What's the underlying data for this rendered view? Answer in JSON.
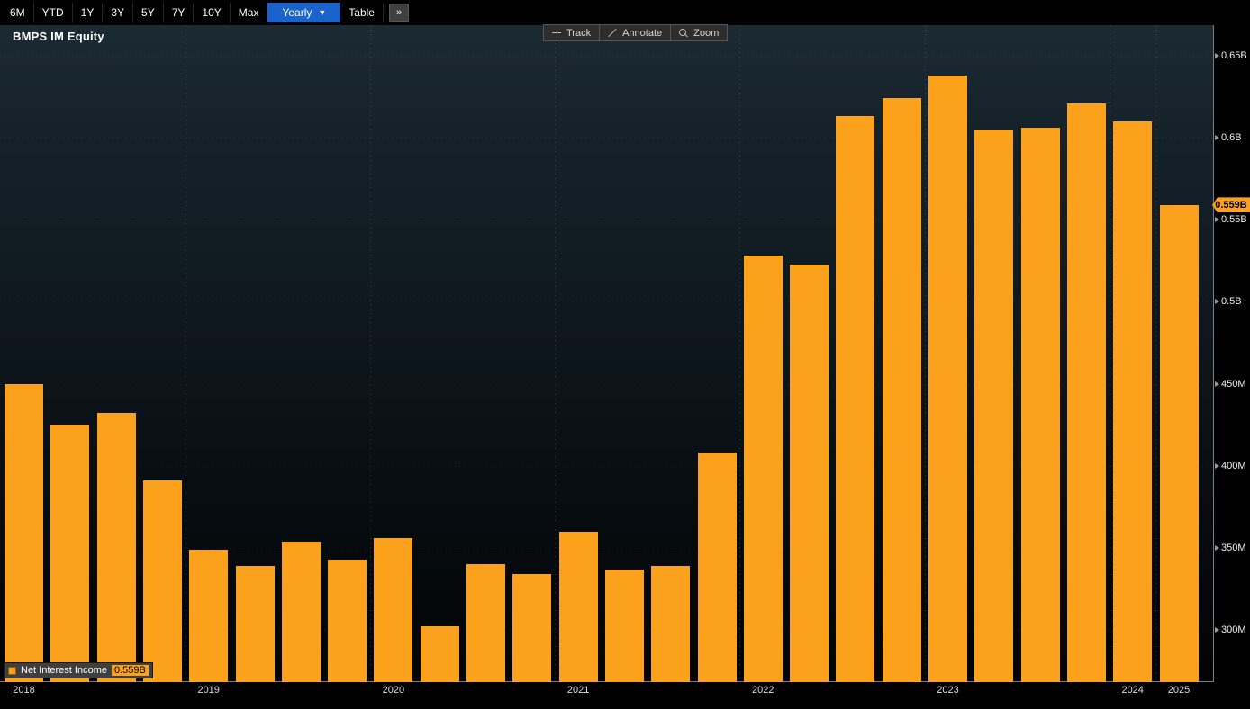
{
  "title": "BMPS IM Equity",
  "toolbar": {
    "period_buttons": [
      "6M",
      "YTD",
      "1Y",
      "3Y",
      "5Y",
      "7Y",
      "10Y",
      "Max"
    ],
    "periodicity_label": "Yearly",
    "periodicity_arrow": "▼",
    "table_label": "Table",
    "more_label": "»"
  },
  "chart_tools": [
    {
      "label": "Track",
      "icon": "crosshair"
    },
    {
      "label": "Annotate",
      "icon": "pencil"
    },
    {
      "label": "Zoom",
      "icon": "magnifier"
    }
  ],
  "legend": {
    "label": "Net Interest Income",
    "value": "0.559B"
  },
  "colors": {
    "bar": "#fba11c",
    "selected_tab": "#1a63c9",
    "axis": "#7d7d7d",
    "badge_bg": "#fba11c",
    "badge_text": "#000000"
  },
  "chart_data": {
    "type": "bar",
    "title": "BMPS IM Equity",
    "series": [
      {
        "name": "Net Interest Income",
        "color": "#fba11c",
        "unit": "millions",
        "periods": [
          "2018 Q1",
          "2018 Q2",
          "2018 Q3",
          "2018 Q4",
          "2019 Q1",
          "2019 Q2",
          "2019 Q3",
          "2019 Q4",
          "2020 Q1",
          "2020 Q2",
          "2020 Q3",
          "2020 Q4",
          "2021 Q1",
          "2021 Q2",
          "2021 Q3",
          "2021 Q4",
          "2022 Q1",
          "2022 Q2",
          "2022 Q3",
          "2022 Q4",
          "2023 Q1",
          "2023 Q2",
          "2023 Q3",
          "2023 Q4",
          "2024",
          "2025"
        ],
        "values_millions": [
          450,
          425,
          432,
          391,
          349,
          339,
          354,
          343,
          356,
          302,
          340,
          334,
          360,
          337,
          339,
          408,
          528,
          523,
          613,
          624,
          638,
          605,
          606,
          621,
          610,
          559
        ]
      }
    ],
    "x_axis": {
      "year_labels": [
        {
          "label": "2018",
          "bar_index": 0
        },
        {
          "label": "2019",
          "bar_index": 4
        },
        {
          "label": "2020",
          "bar_index": 8
        },
        {
          "label": "2021",
          "bar_index": 12
        },
        {
          "label": "2022",
          "bar_index": 16
        },
        {
          "label": "2023",
          "bar_index": 20
        },
        {
          "label": "2024",
          "bar_index": 24
        },
        {
          "label": "2025",
          "bar_index": 25
        }
      ]
    },
    "y_axis": {
      "side": "right",
      "ticks": [
        {
          "value": 650,
          "label": "0.65B"
        },
        {
          "value": 600,
          "label": "0.6B"
        },
        {
          "value": 550,
          "label": "0.55B"
        },
        {
          "value": 500,
          "label": "0.5B"
        },
        {
          "value": 450,
          "label": "450M"
        },
        {
          "value": 400,
          "label": "400M"
        },
        {
          "value": 350,
          "label": "350M"
        },
        {
          "value": 300,
          "label": "300M"
        }
      ],
      "ylim_millions": [
        268,
        683
      ]
    },
    "last_value": {
      "value_millions": 559,
      "label": "0.559B"
    },
    "grid": "dotted-vertical-at-year-boundaries",
    "legend_position": "bottom-left"
  }
}
